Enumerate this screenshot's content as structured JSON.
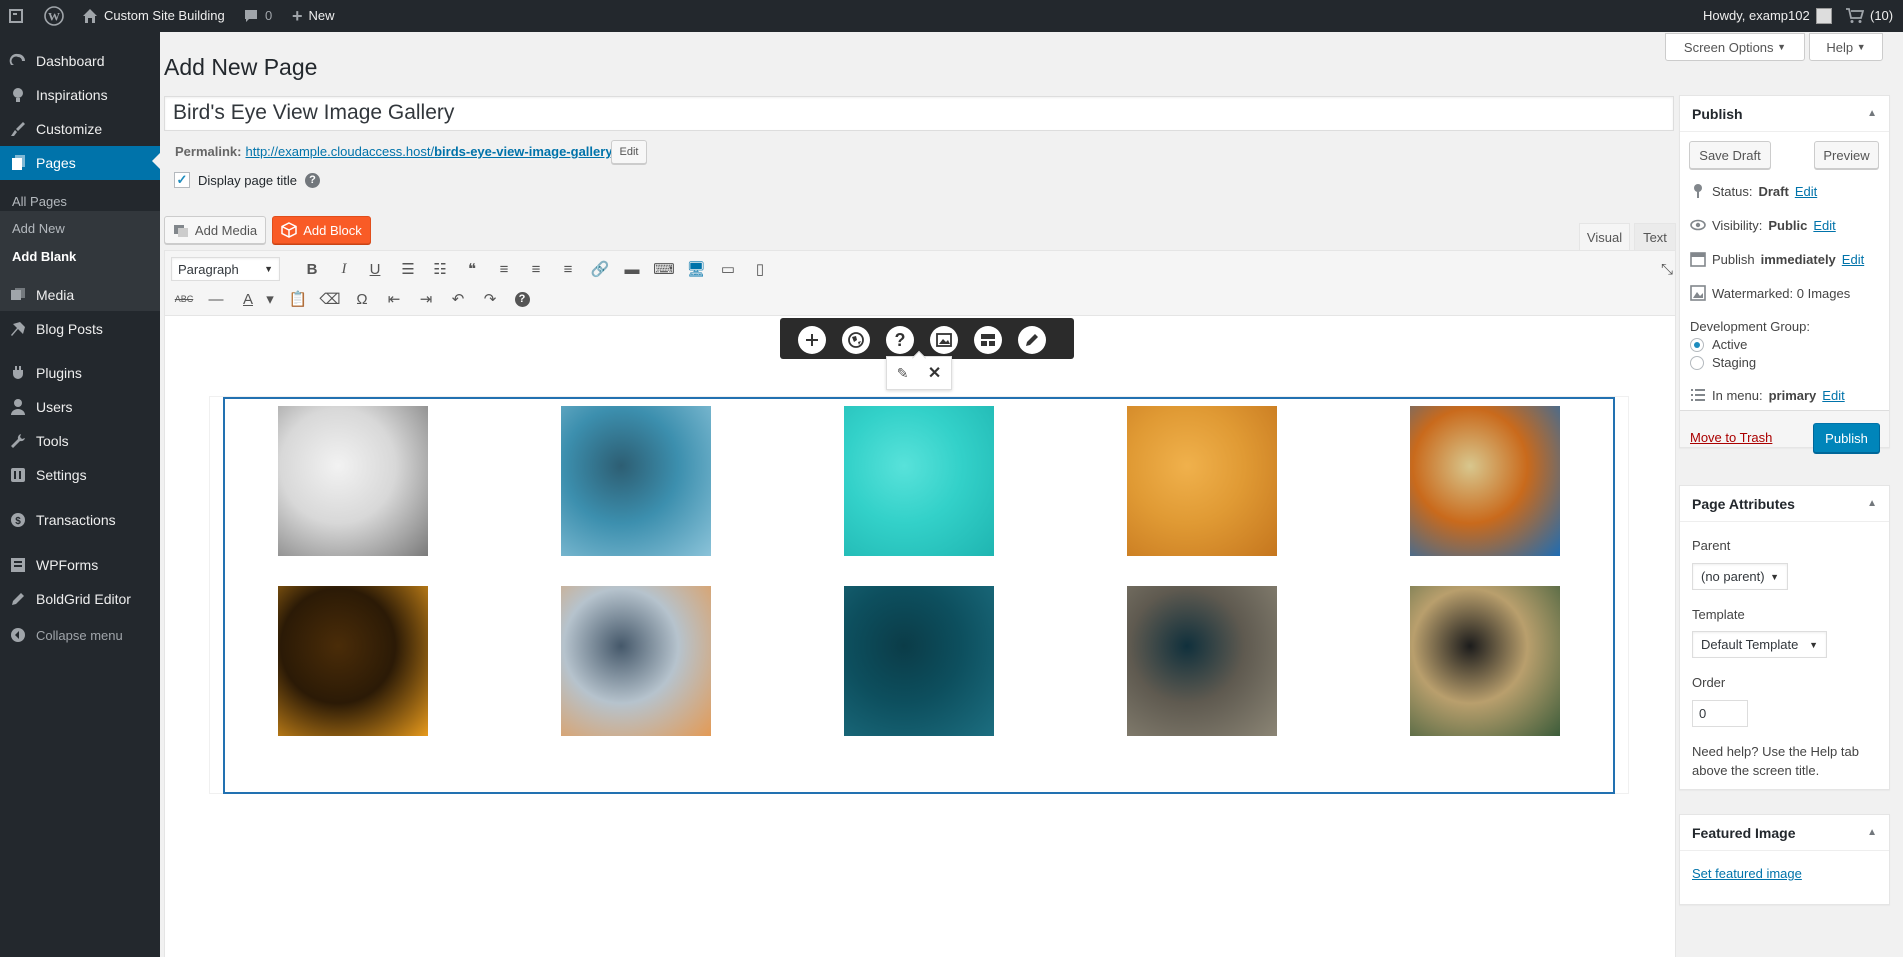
{
  "adminbar": {
    "site_name": "Custom Site Building",
    "comments_count": "0",
    "new_label": "New",
    "howdy": "Howdy, examp102",
    "cart_count": "(10)"
  },
  "sidebar": {
    "items": [
      {
        "label": "Dashboard",
        "icon": "dashboard-icon"
      },
      {
        "label": "Inspirations",
        "icon": "lightbulb-icon"
      },
      {
        "label": "Customize",
        "icon": "brush-icon"
      },
      {
        "label": "Pages",
        "icon": "pages-icon"
      },
      {
        "label": "Media",
        "icon": "media-icon"
      },
      {
        "label": "Blog Posts",
        "icon": "pin-icon"
      },
      {
        "label": "Plugins",
        "icon": "plugin-icon"
      },
      {
        "label": "Users",
        "icon": "users-icon"
      },
      {
        "label": "Tools",
        "icon": "wrench-icon"
      },
      {
        "label": "Settings",
        "icon": "settings-icon"
      },
      {
        "label": "Transactions",
        "icon": "transactions-icon"
      },
      {
        "label": "WPForms",
        "icon": "forms-icon"
      },
      {
        "label": "BoldGrid Editor",
        "icon": "pencil-icon"
      },
      {
        "label": "Collapse menu",
        "icon": "collapse-icon"
      }
    ],
    "submenu": [
      "All Pages",
      "Add New",
      "Add Blank"
    ]
  },
  "header": {
    "title": "Add New Page",
    "screen_options": "Screen Options",
    "help": "Help"
  },
  "editor": {
    "page_title": "Bird's Eye View Image Gallery",
    "permalink_label": "Permalink:",
    "permalink_base": "http://example.cloudaccess.host/",
    "permalink_slug": "birds-eye-view-image-gallery",
    "permalink_end": "/",
    "permalink_edit": "Edit",
    "display_title": "Display page title",
    "add_media": "Add Media",
    "add_block": "Add Block",
    "tab_visual": "Visual",
    "tab_text": "Text",
    "format_select": "Paragraph",
    "images": [
      {
        "name": "snowy-forest-road",
        "colors": [
          "#d8d8d8",
          "#7a7a7a",
          "#f2f2f2"
        ]
      },
      {
        "name": "harbour-bridge",
        "colors": [
          "#3c8fae",
          "#8bc3d9",
          "#2d5e73"
        ]
      },
      {
        "name": "turquoise-sea-sharks",
        "colors": [
          "#33d1c9",
          "#1fb5b1",
          "#58e2da"
        ]
      },
      {
        "name": "wheat-field-harvester",
        "colors": [
          "#e09a34",
          "#c5761e",
          "#f0b14c"
        ]
      },
      {
        "name": "hot-spring",
        "colors": [
          "#c96a1c",
          "#1e6cb3",
          "#d8c78e"
        ]
      },
      {
        "name": "highway-interchange-night",
        "colors": [
          "#2b1a06",
          "#e79a1c",
          "#4a2c08"
        ]
      },
      {
        "name": "dunes-helicopter",
        "colors": [
          "#b6c3cd",
          "#e39a55",
          "#45586a"
        ]
      },
      {
        "name": "cargo-ship",
        "colors": [
          "#0d4f5e",
          "#1c6e80",
          "#0b3c48"
        ]
      },
      {
        "name": "cliff-edge",
        "colors": [
          "#5f5a50",
          "#8b8575",
          "#10303c"
        ]
      },
      {
        "name": "temple-maze",
        "colors": [
          "#b99f6d",
          "#3c5c3a",
          "#1c1c1c"
        ]
      }
    ]
  },
  "publish": {
    "title": "Publish",
    "save_draft": "Save Draft",
    "preview": "Preview",
    "status_label": "Status:",
    "status_value": "Draft",
    "visibility_label": "Visibility:",
    "visibility_value": "Public",
    "publish_label": "Publish",
    "publish_value": "immediately",
    "edit": "Edit",
    "watermarked": "Watermarked: 0 Images",
    "dev_group": "Development Group:",
    "active": "Active",
    "staging": "Staging",
    "in_menu_label": "In menu:",
    "in_menu_value": "primary",
    "trash": "Move to Trash",
    "publish_button": "Publish"
  },
  "attributes": {
    "title": "Page Attributes",
    "parent_label": "Parent",
    "parent_value": "(no parent)",
    "template_label": "Template",
    "template_value": "Default Template",
    "order_label": "Order",
    "order_value": "0",
    "help_text": "Need help? Use the Help tab above the screen title."
  },
  "featured": {
    "title": "Featured Image",
    "link": "Set featured image"
  }
}
